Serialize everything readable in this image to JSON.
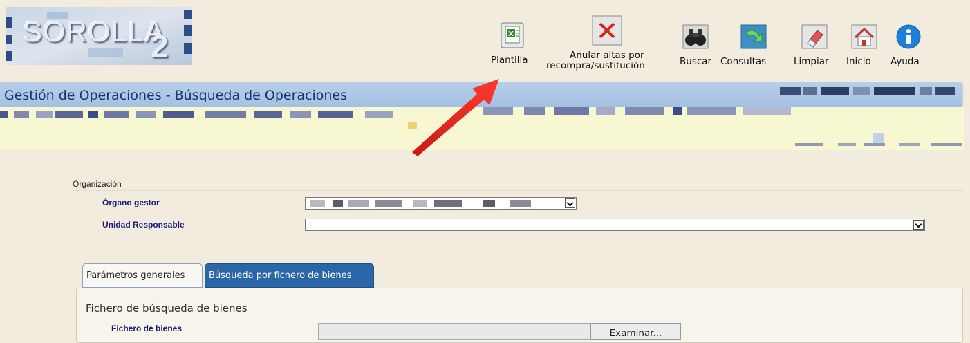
{
  "app": {
    "logo_text": "SOROLLA",
    "logo_sub": "2"
  },
  "toolbar": {
    "plantilla": "Plantilla",
    "anular_line1": "Anular altas por",
    "anular_line2": "recompra/sustitución",
    "buscar": "Buscar",
    "consultas": "Consultas",
    "limpiar": "Limpiar",
    "inicio": "Inicio",
    "ayuda": "Ayuda"
  },
  "page": {
    "title": "Gestión de Operaciones - Búsqueda de Operaciones"
  },
  "form": {
    "section_label": "Organización",
    "organo_label": "Órgano gestor",
    "unidad_label": "Unidad Responsable",
    "unidad_value": ""
  },
  "tabs": [
    {
      "label": "Parámetros generales",
      "active": false
    },
    {
      "label": "Búsqueda por fichero de bienes",
      "active": true
    }
  ],
  "panel": {
    "section_title": "Fichero de búsqueda de bienes",
    "file_label": "Fichero de bienes",
    "browse_label": "Examinar..."
  },
  "colors": {
    "background": "#f2ecdf",
    "title_bar": "#a9c4e4",
    "title_text": "#15356e",
    "band": "#f7f8d2",
    "active_tab": "#2b66a8",
    "field_label": "#1a1a7a",
    "arrow": "#e8261f"
  },
  "icons": [
    "excel-icon",
    "cancel-x-icon",
    "binoculars-icon",
    "refresh-arrow-icon",
    "eraser-icon",
    "home-icon",
    "info-icon"
  ]
}
